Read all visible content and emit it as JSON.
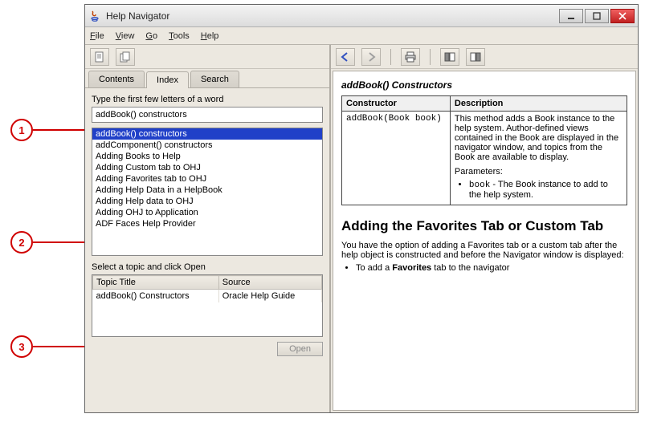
{
  "window": {
    "title": "Help Navigator"
  },
  "menu": {
    "file": "File",
    "view": "View",
    "go": "Go",
    "tools": "Tools",
    "help": "Help"
  },
  "left": {
    "tabs": {
      "contents": "Contents",
      "index": "Index",
      "search": "Search"
    },
    "prompt": "Type the first few letters of a word",
    "input_value": "addBook() constructors",
    "index_items": [
      "addBook() constructors",
      "addComponent() constructors",
      "Adding Books to Help",
      "Adding Custom tab to OHJ",
      "Adding Favorites tab to OHJ",
      "Adding Help Data in a HelpBook",
      "Adding Help data to OHJ",
      "Adding OHJ to Application",
      "ADF Faces Help Provider"
    ],
    "selected_index": 0,
    "topics_label": "Select a topic and click Open",
    "topics_headers": {
      "title": "Topic Title",
      "source": "Source"
    },
    "topics_rows": [
      {
        "title": "addBook() Constructors",
        "source": "Oracle Help Guide"
      }
    ],
    "open_label": "Open"
  },
  "right": {
    "doc_title": "addBook() Constructors",
    "table_headers": {
      "constructor": "Constructor",
      "description": "Description"
    },
    "constructor_code": "addBook(Book book)",
    "desc_main": "This method adds a Book instance to the help system. Author-defined views contained in the Book are displayed in the navigator window, and topics from the Book are available to display.",
    "desc_params_label": "Parameters:",
    "desc_param_item_code": "book",
    "desc_param_item_text": " - The Book instance to add to the help system.",
    "section_heading": "Adding the Favorites Tab or Custom Tab",
    "section_para": "You have the option of adding a Favorites tab or a custom tab after the help object is constructed and before the Navigator window is displayed:",
    "section_li_prefix": "To add a ",
    "section_li_bold": "Favorites",
    "section_li_suffix": " tab to the navigator"
  },
  "callouts": {
    "one": "1",
    "two": "2",
    "three": "3"
  }
}
